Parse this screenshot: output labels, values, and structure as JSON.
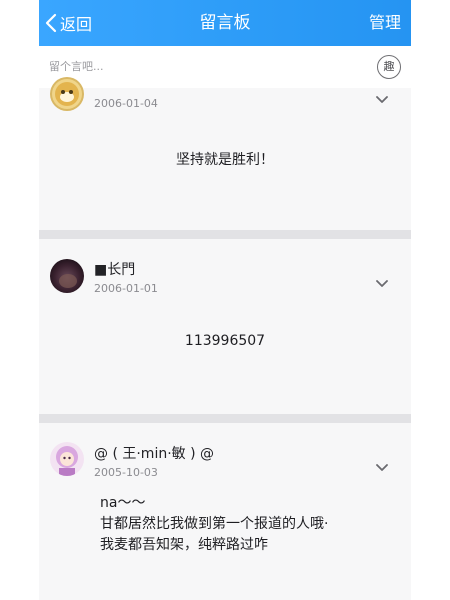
{
  "nav": {
    "back_label": "返回",
    "title": "留言板",
    "manage_label": "管理",
    "back_icon": "chevron-left-icon"
  },
  "composer": {
    "placeholder": "留个言吧...",
    "emoji_label": "趣",
    "emoji_icon": "emoji-icon"
  },
  "colors": {
    "nav_accent": "#2e9df8",
    "background": "#f4f4f6",
    "separator": "#e2e2e5"
  },
  "messages": [
    {
      "author": "",
      "date": "2006-01-04",
      "content": [
        "坚持就是胜利！"
      ]
    },
    {
      "author": "■长門",
      "date": "2006-01-01",
      "content": [
        "113996507"
      ]
    },
    {
      "author": "@ ( 王·min·敏 ) @",
      "date": "2005-10-03",
      "content": [
        "na～～",
        "甘都居然比我做到第一个报道的人哦·",
        "我麦都吾知架，纯粹路过咋"
      ]
    }
  ]
}
